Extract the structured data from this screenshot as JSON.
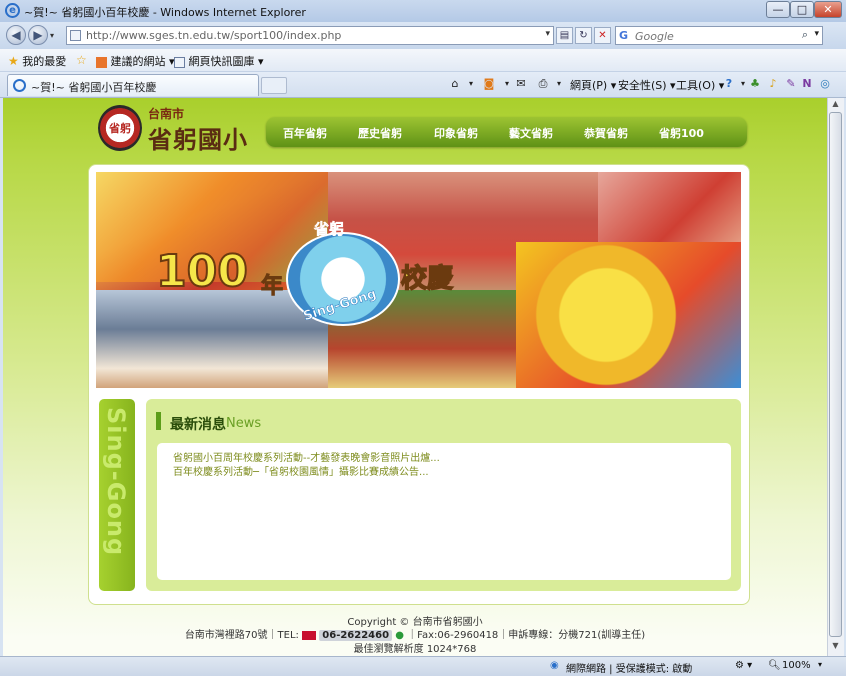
{
  "window": {
    "title": "~賀!~ 省躬國小百年校慶 - Windows Internet Explorer",
    "minimize": "—",
    "maximize": "□",
    "close": "✕"
  },
  "address_bar": {
    "url": "http://www.sges.tn.edu.tw/sport100/index.php"
  },
  "search": {
    "placeholder": "Google"
  },
  "favorites_bar": {
    "favorites_label": "我的最愛",
    "suggested_sites": "建議的網站 ▾",
    "web_slice_gallery": "網頁快訊圖庫 ▾"
  },
  "tab": {
    "label": "~賀!~ 省躬國小百年校慶"
  },
  "command_bar": {
    "page": "網頁(P) ▾",
    "safety": "安全性(S) ▾",
    "tools": "工具(O) ▾"
  },
  "site": {
    "logo_text": "省躬",
    "city": "台南市",
    "school_name": "省躬國小",
    "nav": [
      "百年省躬",
      "歷史省躬",
      "印象省躬",
      "藝文省躬",
      "恭賀省躬",
      "省躬100"
    ]
  },
  "banner": {
    "big_number": "100",
    "year_char": "年",
    "celebration": "校慶",
    "badge_text": "省躬",
    "sing_gong": "Sing-Gong"
  },
  "side_tab": {
    "text": "Sing-Gong"
  },
  "news": {
    "heading_zh": "最新消息",
    "heading_en": "News",
    "items": [
      "省躬國小百周年校慶系列活動--才藝發表晚會影音照片出爐...",
      "百年校慶系列活動─「省躬校園風情」攝影比賽成績公告..."
    ]
  },
  "footer": {
    "copyright": "Copyright © 台南市省躬國小",
    "address_prefix": "台南市灣裡路70號｜TEL:",
    "phone": "06-2622460",
    "address_suffix": "｜Fax:06-2960418｜申訴專線：分機721(訓導主任)",
    "resolution": "最佳瀏覽解析度 1024*768"
  },
  "status_bar": {
    "zone": "網際網路 | 受保護模式: 啟動",
    "zoom": "100%"
  },
  "colors": {
    "brand_green": "#8cbf24",
    "nav_green": "#6ea01c",
    "link_color": "#7e8c1d"
  }
}
